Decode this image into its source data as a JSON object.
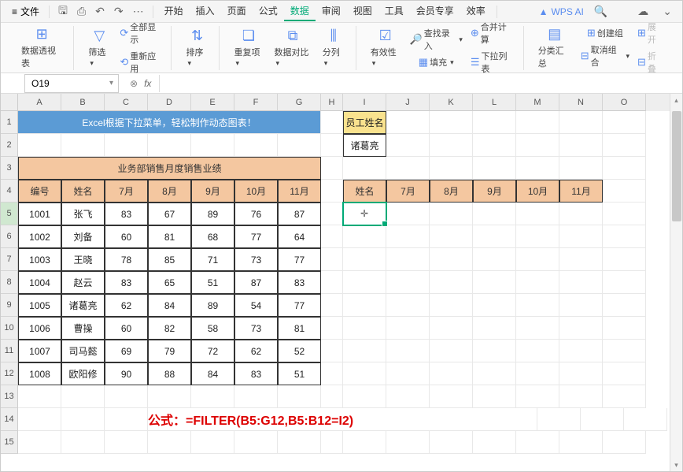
{
  "menubar": {
    "file": "文件",
    "tabs": [
      "开始",
      "插入",
      "页面",
      "公式",
      "数据",
      "审阅",
      "视图",
      "工具",
      "会员专享",
      "效率"
    ],
    "active_tab_index": 4,
    "ai_label": "WPS AI"
  },
  "ribbon": {
    "pivot": "数据透视表",
    "filter": "筛选",
    "show_all": "全部显示",
    "reapply": "重新应用",
    "sort": "排序",
    "duplicates": "重复项",
    "data_compare": "数据对比",
    "split": "分列",
    "validation": "有效性",
    "fill": "填充",
    "find_input": "查找录入",
    "consolidate": "合并计算",
    "dropdown": "下拉列表",
    "subtotal": "分类汇总",
    "group": "创建组",
    "ungroup": "取消组合",
    "expand": "展开",
    "collapse": "折叠"
  },
  "namebox": {
    "value": "O19"
  },
  "columns": [
    "A",
    "B",
    "C",
    "D",
    "E",
    "F",
    "G",
    "H",
    "I",
    "J",
    "K",
    "L",
    "M",
    "N",
    "O"
  ],
  "rows": [
    "1",
    "2",
    "3",
    "4",
    "5",
    "6",
    "7",
    "8",
    "9",
    "10",
    "11",
    "12",
    "13",
    "14",
    "15"
  ],
  "title_banner": "Excel根据下拉菜单，轻松制作动态图表！",
  "section_title": "业务部销售月度销售业绩",
  "table_headers": [
    "编号",
    "姓名",
    "7月",
    "8月",
    "9月",
    "10月",
    "11月"
  ],
  "table_rows": [
    [
      "1001",
      "张飞",
      "83",
      "67",
      "89",
      "76",
      "87"
    ],
    [
      "1002",
      "刘备",
      "60",
      "81",
      "68",
      "77",
      "64"
    ],
    [
      "1003",
      "王晓",
      "78",
      "85",
      "71",
      "73",
      "77"
    ],
    [
      "1004",
      "赵云",
      "83",
      "65",
      "51",
      "87",
      "83"
    ],
    [
      "1005",
      "诸葛亮",
      "62",
      "84",
      "89",
      "54",
      "77"
    ],
    [
      "1006",
      "曹操",
      "60",
      "82",
      "58",
      "73",
      "81"
    ],
    [
      "1007",
      "司马懿",
      "69",
      "79",
      "72",
      "62",
      "52"
    ],
    [
      "1008",
      "欧阳修",
      "90",
      "88",
      "84",
      "83",
      "51"
    ]
  ],
  "emp_name_label": "员工姓名",
  "emp_name_value": "诸葛亮",
  "right_headers": [
    "姓名",
    "7月",
    "8月",
    "9月",
    "10月",
    "11月"
  ],
  "formula_label": "公式：",
  "formula_text": "=FILTER(B5:G12,B5:B12=I2)"
}
